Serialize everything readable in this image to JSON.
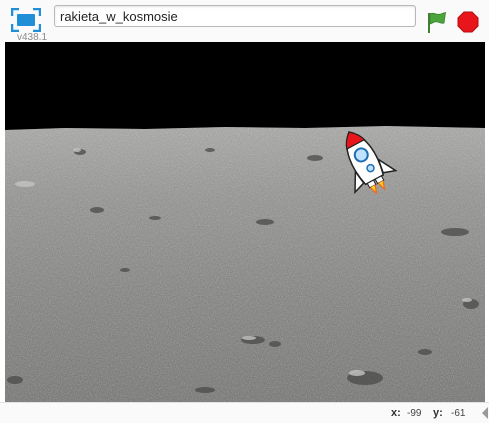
{
  "header": {
    "project_title": "rakieta_w_kosmosie",
    "version": "v438.1"
  },
  "icons": {
    "fullscreen": "fullscreen-icon",
    "green_flag": "green-flag-icon",
    "stop": "stop-icon",
    "sprite": "rocket-icon"
  },
  "colors": {
    "green_flag": "#4ca53a",
    "stop": "#e8161b",
    "fullscreen_blue": "#1f8fd6"
  },
  "status": {
    "x_label": "x:",
    "x_value": "-99",
    "y_label": "y:",
    "y_value": "-61"
  }
}
